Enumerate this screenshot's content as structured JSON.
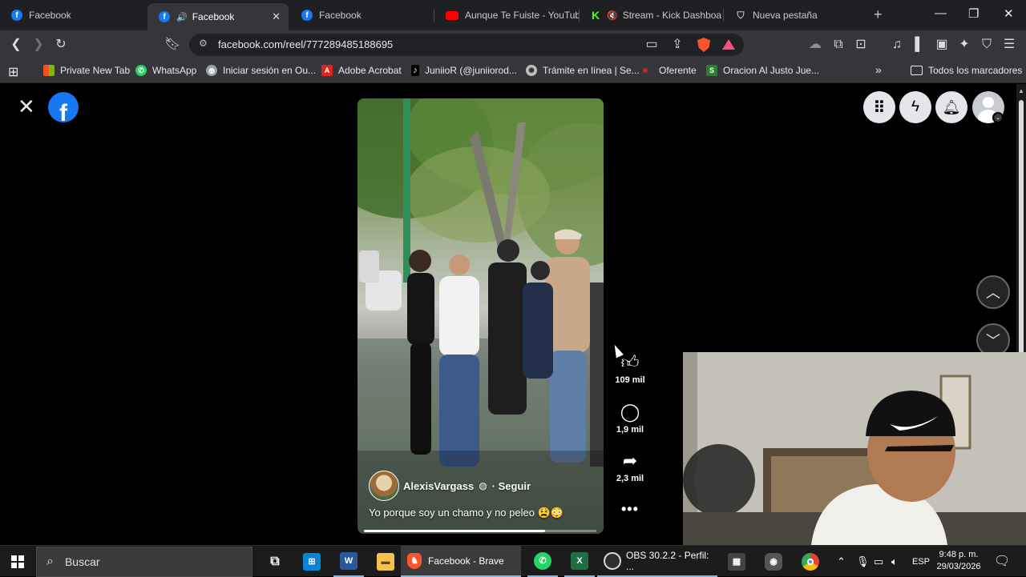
{
  "browser": {
    "tabs": [
      {
        "title": "Facebook",
        "favicon": "facebook-icon",
        "active": false
      },
      {
        "title": "Facebook",
        "favicon": "facebook-icon",
        "active": true,
        "audio": true
      },
      {
        "title": "Facebook",
        "favicon": "facebook-icon",
        "active": false
      },
      {
        "title": "Aunque Te Fuiste - YouTube",
        "favicon": "youtube-icon",
        "active": false
      },
      {
        "title": "Stream - Kick Dashboard",
        "favicon": "kick-icon",
        "active": false,
        "muted": true
      },
      {
        "title": "Nueva pestaña",
        "favicon": "brave-icon",
        "active": false
      }
    ],
    "url": "facebook.com/reel/777289485188695",
    "bookmarks": [
      {
        "label": "Private New Tab",
        "icon": "windows-icon",
        "color": "#f25022"
      },
      {
        "label": "WhatsApp",
        "icon": "whatsapp-icon",
        "color": "#25d366"
      },
      {
        "label": "Iniciar sesión en Ou...",
        "icon": "globe-icon",
        "color": "#9aa0a6"
      },
      {
        "label": "Adobe Acrobat",
        "icon": "acrobat-icon",
        "color": "#e1251b"
      },
      {
        "label": "JuniioR (@juniiorod...",
        "icon": "tiktok-icon",
        "color": "#000000"
      },
      {
        "label": "Trámite en línea | Se...",
        "icon": "seal-icon",
        "color": "#bdbdbd"
      },
      {
        "label": "Oferente",
        "icon": "circle-icon",
        "color": "#c62828"
      },
      {
        "label": "Oracion Al Justo Jue...",
        "icon": "s-icon",
        "color": "#2e7d32"
      }
    ],
    "all_bookmarks_label": "Todos los marcadores"
  },
  "reel": {
    "author": "AlexisVargass",
    "follow_label": "· Seguir",
    "caption": "Yo porque soy un chamo y no peleo 😫😳",
    "likes": "109 mil",
    "comments": "1,9 mil",
    "shares": "2,3 mil",
    "progress": 0.78
  },
  "taskbar": {
    "search_placeholder": "Buscar",
    "active_app": "Facebook - Brave",
    "obs_app": "OBS 30.2.2 - Perfil: ...",
    "language": "ESP",
    "time": "9:48 p. m.",
    "date": "29/03/2026"
  }
}
